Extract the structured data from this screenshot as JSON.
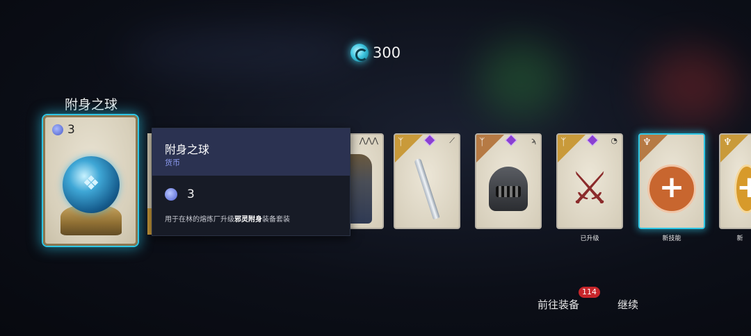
{
  "currency": {
    "icon": "spirit-coin-icon",
    "value": "300"
  },
  "selected_item": {
    "name": "附身之球",
    "count": "3",
    "count_icon": "orb-count-icon"
  },
  "tooltip": {
    "title": "附身之球",
    "kind": "货币",
    "amount": "3",
    "desc_pre": "用于在林的熔炼厂升级",
    "desc_bold": "邪灵附身",
    "desc_post": "装备套装"
  },
  "cards": [
    {
      "id": "knight",
      "art": "armor",
      "label": ""
    },
    {
      "id": "sword",
      "art": "sword",
      "label": ""
    },
    {
      "id": "helmet",
      "art": "helmet",
      "label": ""
    },
    {
      "id": "axes",
      "art": "double-axe",
      "label": "已升级"
    },
    {
      "id": "skill1",
      "art": "skill",
      "label": "新技能"
    },
    {
      "id": "skill2",
      "art": "skill",
      "label": "新"
    }
  ],
  "bottom": {
    "goto_equip": "前往装备",
    "badge": "114",
    "continue": "继续"
  },
  "colors": {
    "accent_cyan": "#2ec7e6",
    "badge_red": "#c7262b",
    "tooltip_head": "#2b3251",
    "currency_name_color": "#8e9cf2"
  }
}
